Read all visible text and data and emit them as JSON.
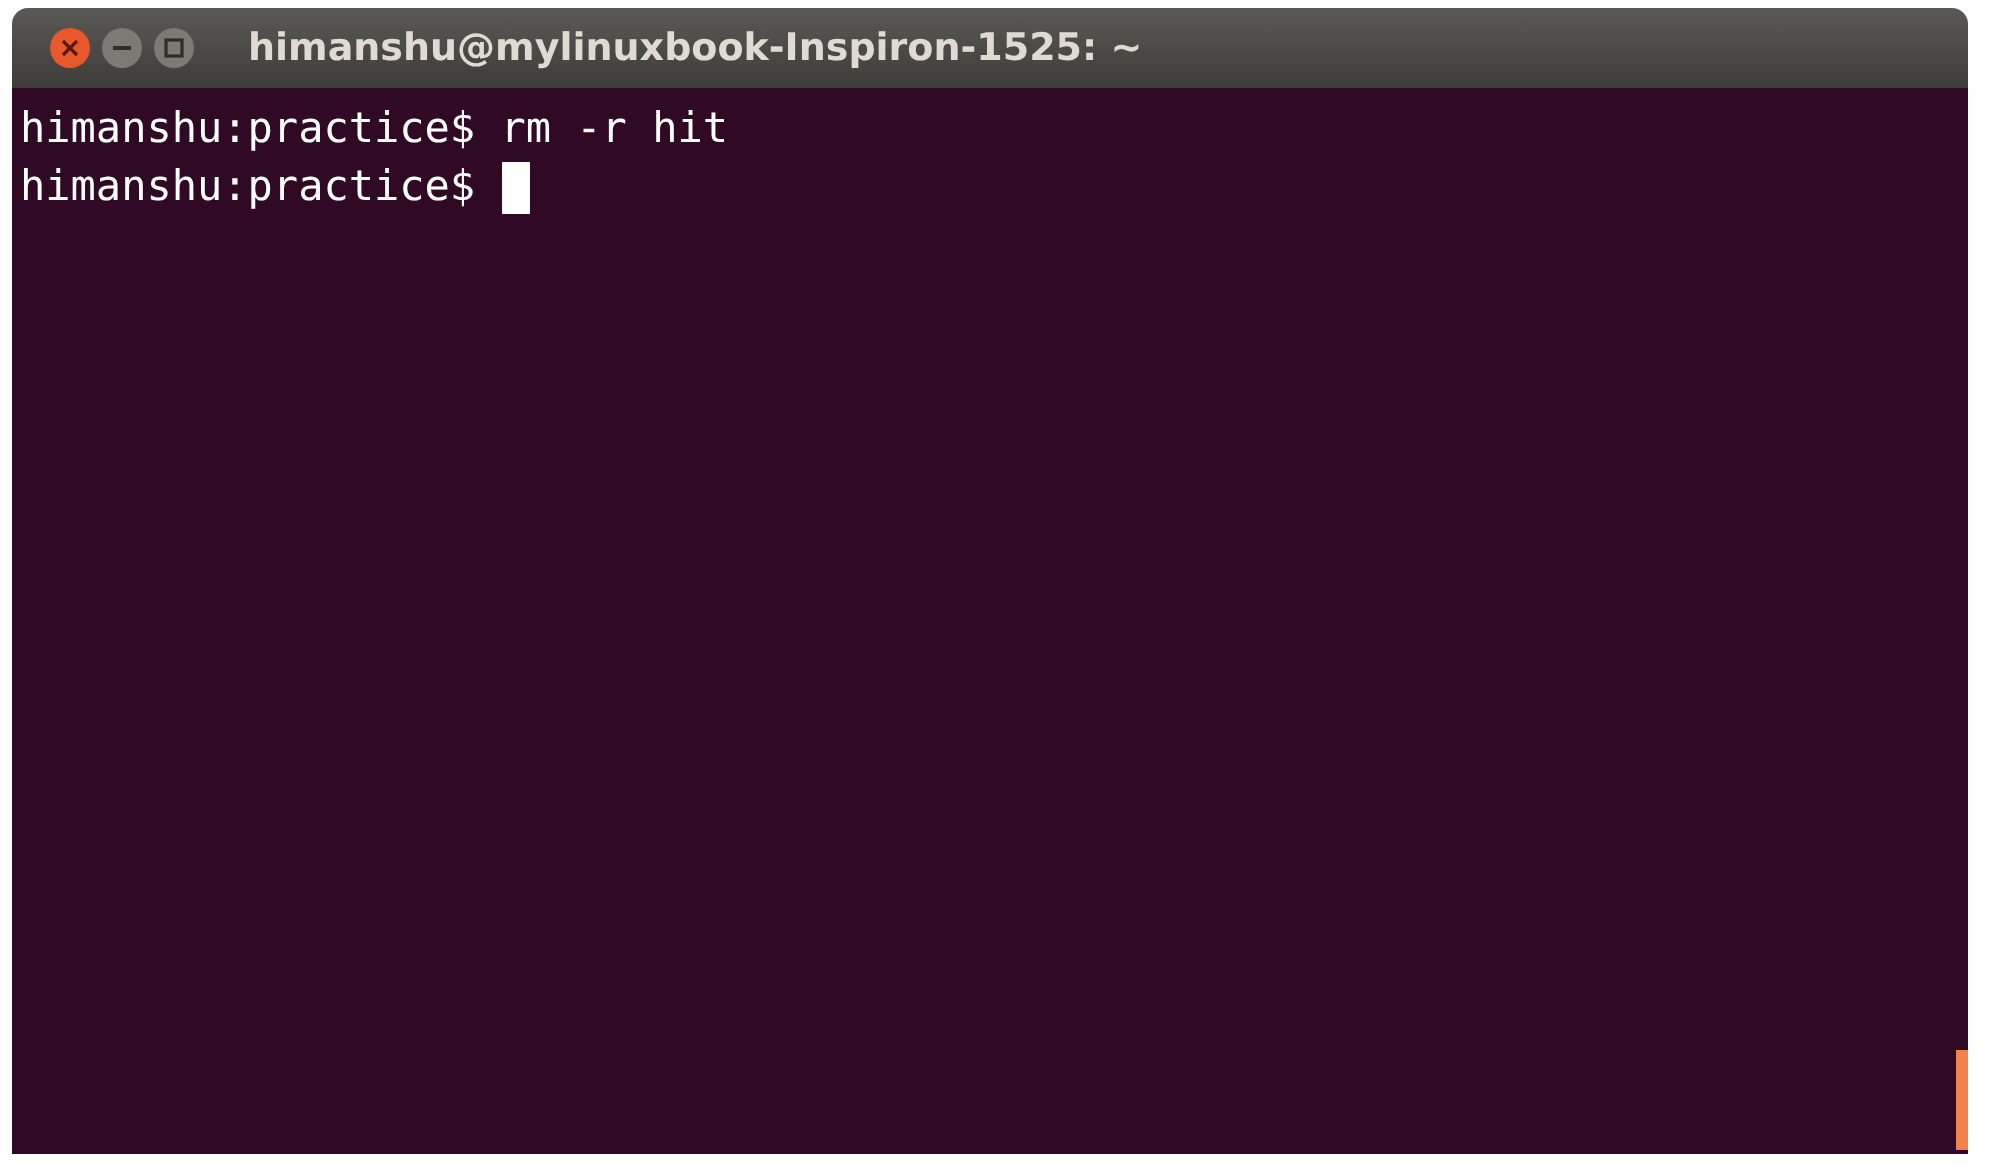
{
  "window": {
    "title": "himanshu@mylinuxbook-Inspiron-1525: ~"
  },
  "terminal": {
    "lines": [
      {
        "text": "himanshu:practice$ rm -r hit",
        "cursor": false
      },
      {
        "text": "himanshu:practice$",
        "cursor": true
      }
    ]
  }
}
